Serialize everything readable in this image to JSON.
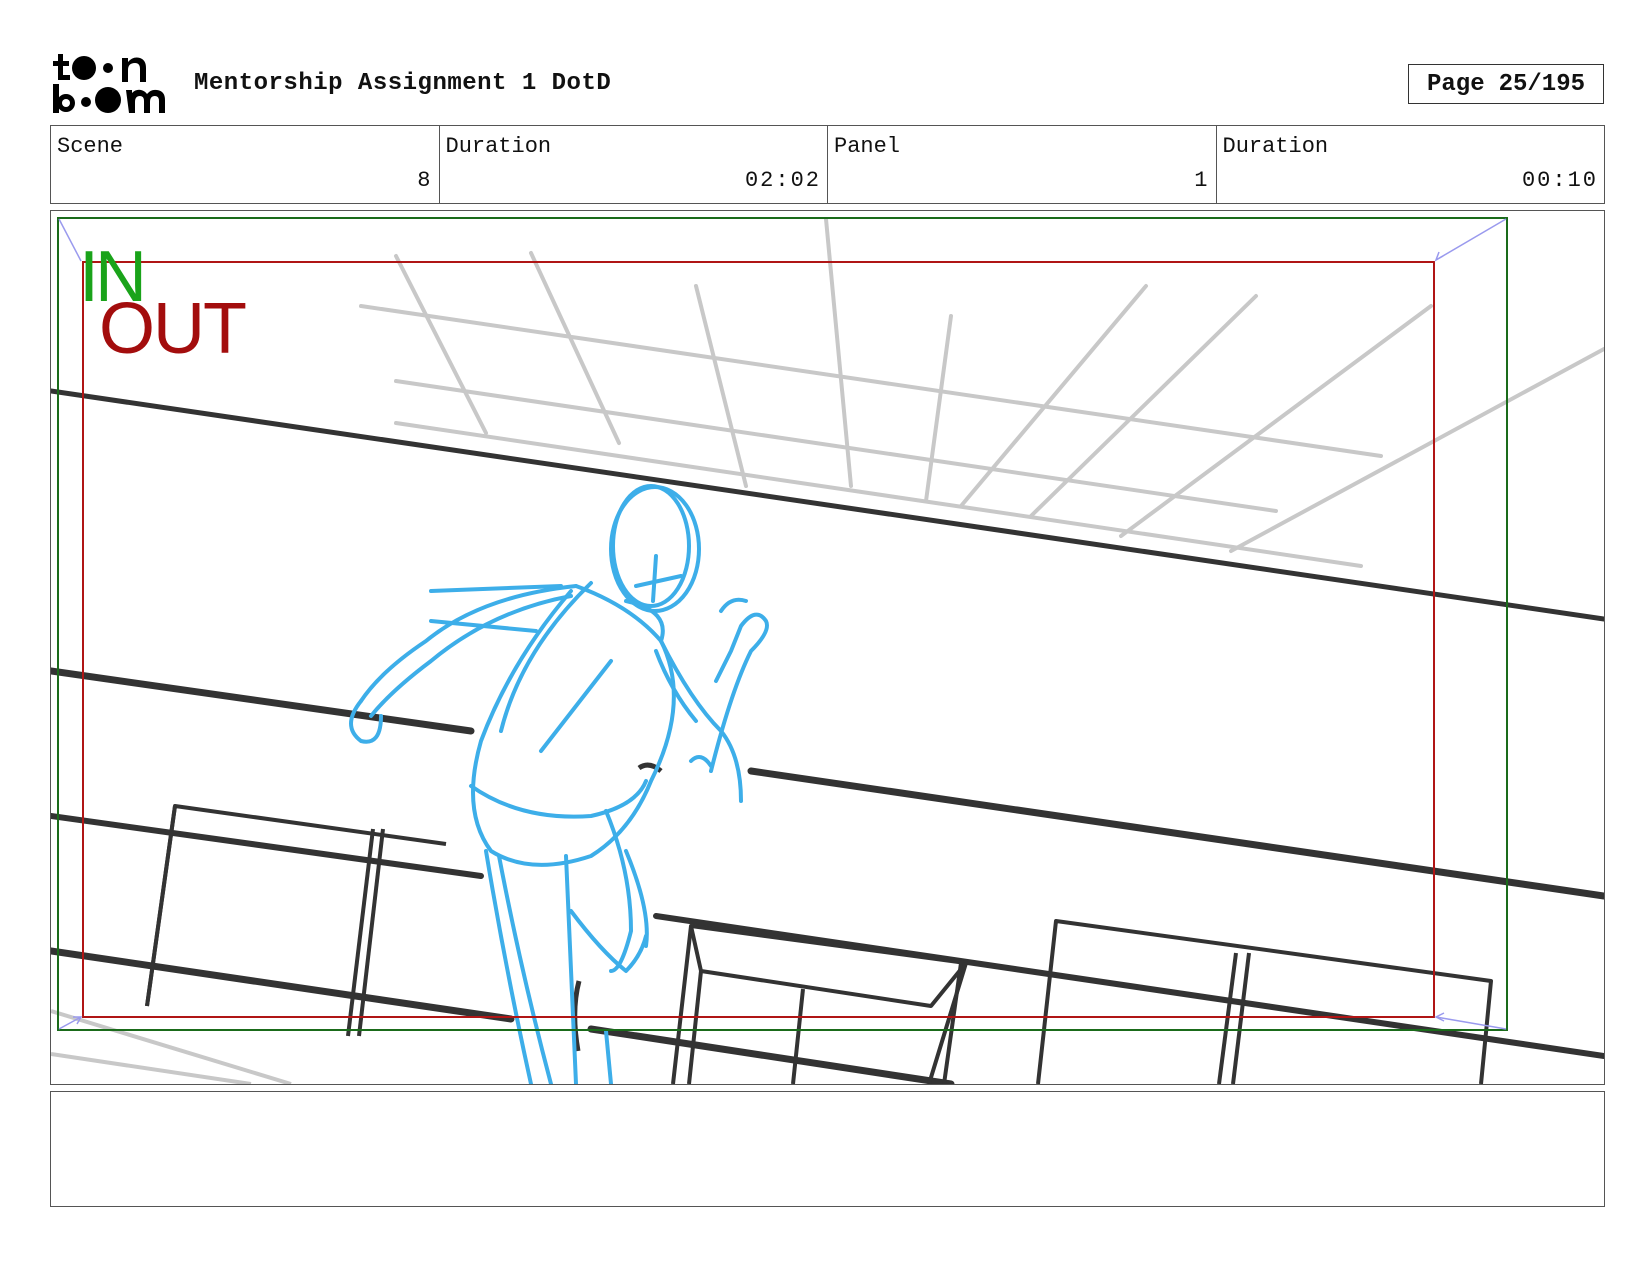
{
  "header": {
    "logo_text": "toon boom",
    "title": "Mentorship Assignment 1 DotD",
    "page_label": "Page",
    "page_value": "25/195"
  },
  "info": {
    "scene_label": "Scene",
    "scene_value": "8",
    "scene_duration_label": "Duration",
    "scene_duration_value": "02:02",
    "panel_label": "Panel",
    "panel_value": "1",
    "panel_duration_label": "Duration",
    "panel_duration_value": "00:10"
  },
  "frame": {
    "in_label": "IN",
    "out_label": "OUT",
    "in_color": "#1aa31a",
    "out_color": "#a30d0d",
    "figure_color": "#3daee9"
  },
  "notes": {
    "text": ""
  }
}
